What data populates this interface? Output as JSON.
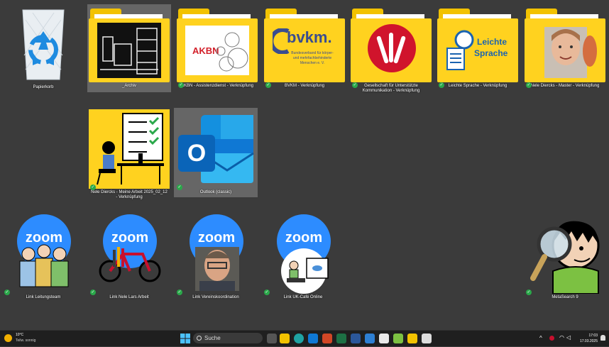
{
  "desktop": {
    "icons": [
      {
        "label": "Papierkorb"
      },
      {
        "label": "_Archiv"
      },
      {
        "label": "AKBN - Assistenzdienst - Verknüpfung",
        "logo_text": "AKBN"
      },
      {
        "label": "BVKM - Verknüpfung",
        "logo_text": "bvkm.",
        "logo_sub": "Bundesverband für körper- und mehrfachbehinderte Menschen e. V."
      },
      {
        "label": "Gesellschaft für Unterstützte Kommunikation - Verknüpfung"
      },
      {
        "label": "Leichte Sprache - Verknüpfung",
        "logo_text_1": "Leichte",
        "logo_text_2": "Sprache"
      },
      {
        "label": "Nele Diercks - Master - Verknüpfung"
      },
      {
        "label": "Nele Diercks - Meine Arbeit 2025_02_12 - Verknüpfung"
      },
      {
        "label": "Outlook (classic)"
      },
      {
        "label": "Link Leitungsteam",
        "zoom_text": "zoom"
      },
      {
        "label": "Link Nele Lars Arbeit",
        "zoom_text": "zoom"
      },
      {
        "label": "Link Vereinskoordination",
        "zoom_text": "zoom"
      },
      {
        "label": "Link UK-Café Online",
        "zoom_text": "zoom"
      },
      {
        "label": "MetaSearch 9"
      }
    ]
  },
  "taskbar": {
    "weather_temp": "10°C",
    "weather_desc": "Teilw. sonnig",
    "search_placeholder": "Suche",
    "time": "17:03",
    "date": "17.03.2025"
  },
  "colors": {
    "folder": "#ffd21f",
    "zoom": "#2d8cff",
    "accent": "#2aa84a"
  }
}
